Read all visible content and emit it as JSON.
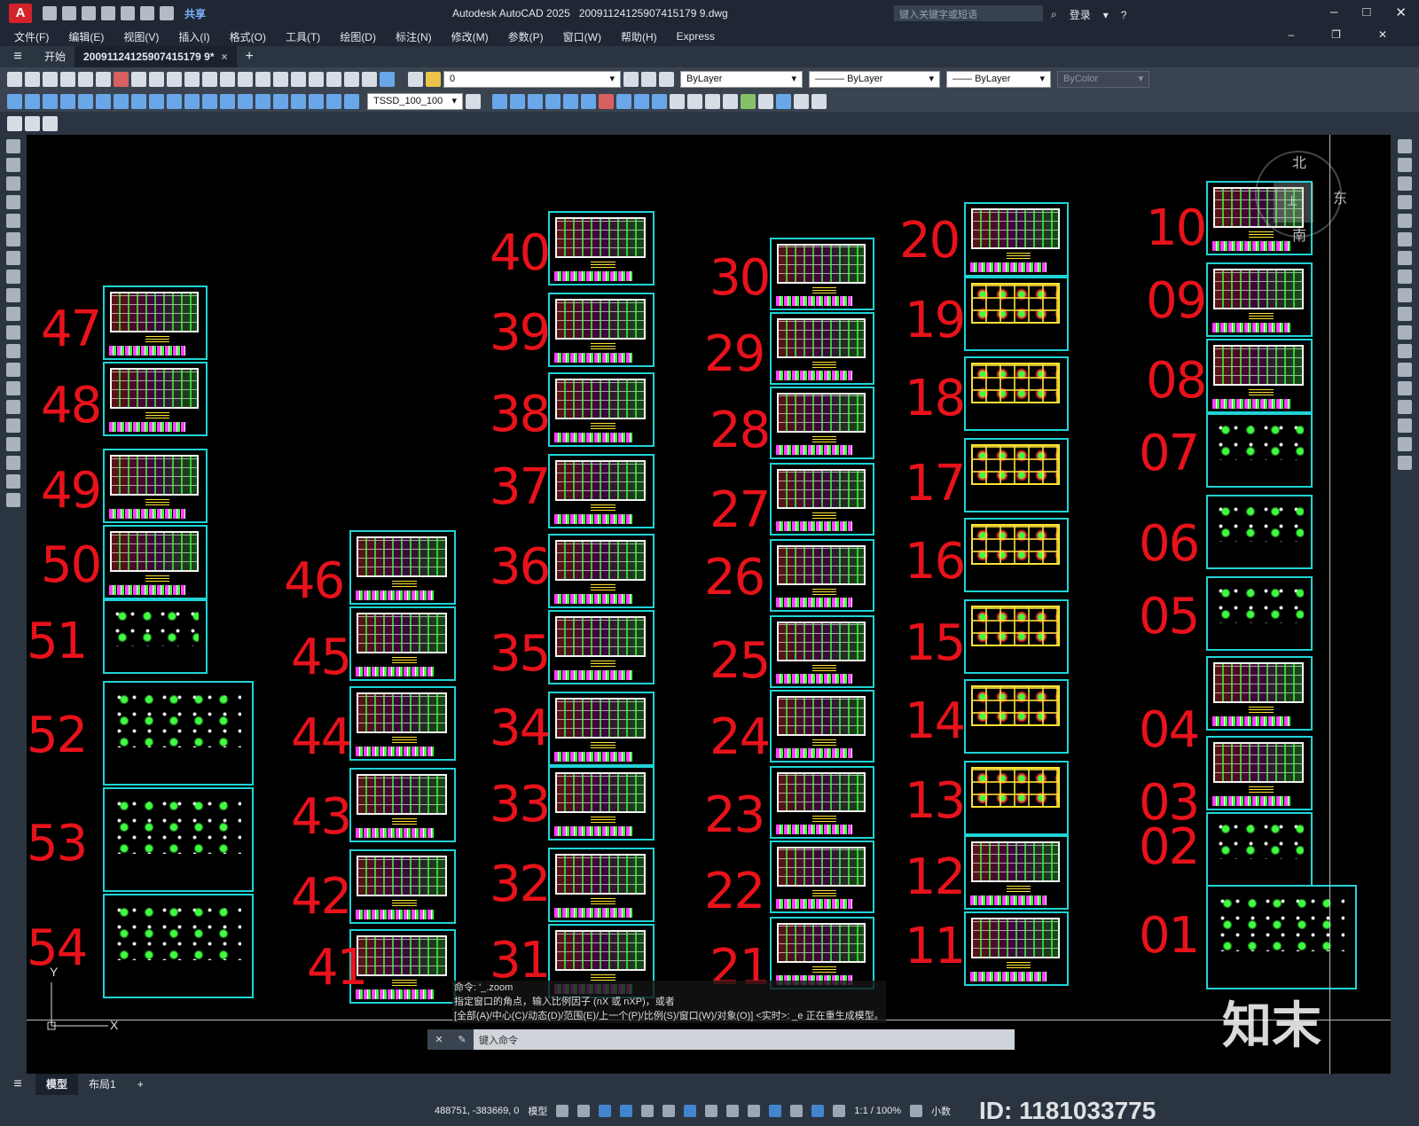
{
  "app": {
    "logo": "A",
    "title": "Autodesk AutoCAD 2025",
    "filename": "20091124125907415179 9.dwg",
    "share": "共享",
    "search_placeholder": "键入关键字或短语",
    "login": "登录"
  },
  "menu": [
    "文件(F)",
    "编辑(E)",
    "视图(V)",
    "插入(I)",
    "格式(O)",
    "工具(T)",
    "绘图(D)",
    "标注(N)",
    "修改(M)",
    "参数(P)",
    "窗口(W)",
    "帮助(H)",
    "Express"
  ],
  "tabs": {
    "start": "开始",
    "file": "20091124125907415179 9*",
    "close": "×",
    "add": "+"
  },
  "toolbar": {
    "layer": "0",
    "color": "ByLayer",
    "linetype": "ByLayer",
    "lineweight": "ByLayer",
    "plotstyle": "ByColor",
    "dimstyle": "TSSD_100_100"
  },
  "compass": {
    "n": "北",
    "e": "东",
    "s": "南",
    "top": "上"
  },
  "sheet_numbers": [
    "47",
    "48",
    "49",
    "50",
    "51",
    "52",
    "53",
    "54",
    "46",
    "45",
    "44",
    "43",
    "42",
    "41",
    "40",
    "39",
    "38",
    "37",
    "36",
    "35",
    "34",
    "33",
    "32",
    "31",
    "30",
    "29",
    "28",
    "27",
    "26",
    "25",
    "24",
    "23",
    "22",
    "21",
    "20",
    "19",
    "18",
    "17",
    "16",
    "15",
    "14",
    "13",
    "12",
    "11",
    "10",
    "09",
    "08",
    "07",
    "06",
    "05",
    "04",
    "03",
    "02",
    "01"
  ],
  "command": {
    "history1": "命令: '_.zoom",
    "history2": "指定窗口的角点，输入比例因子 (nX 或 nXP)，或者",
    "history3": "[全部(A)/中心(C)/动态(D)/范围(E)/上一个(P)/比例(S)/窗口(W)/对象(O)] <实时>: _e 正在重生成模型。",
    "placeholder": "键入命令"
  },
  "ucs": {
    "y": "Y",
    "x": "X"
  },
  "layout_tabs": {
    "model": "模型",
    "layout1": "布局1",
    "add": "+"
  },
  "status": {
    "coords": "488751, -383669, 0",
    "space": "模型",
    "scale": "1:1 / 100%",
    "units": "小数"
  },
  "watermark": {
    "brand": "知末",
    "id": "ID: 1181033775"
  }
}
